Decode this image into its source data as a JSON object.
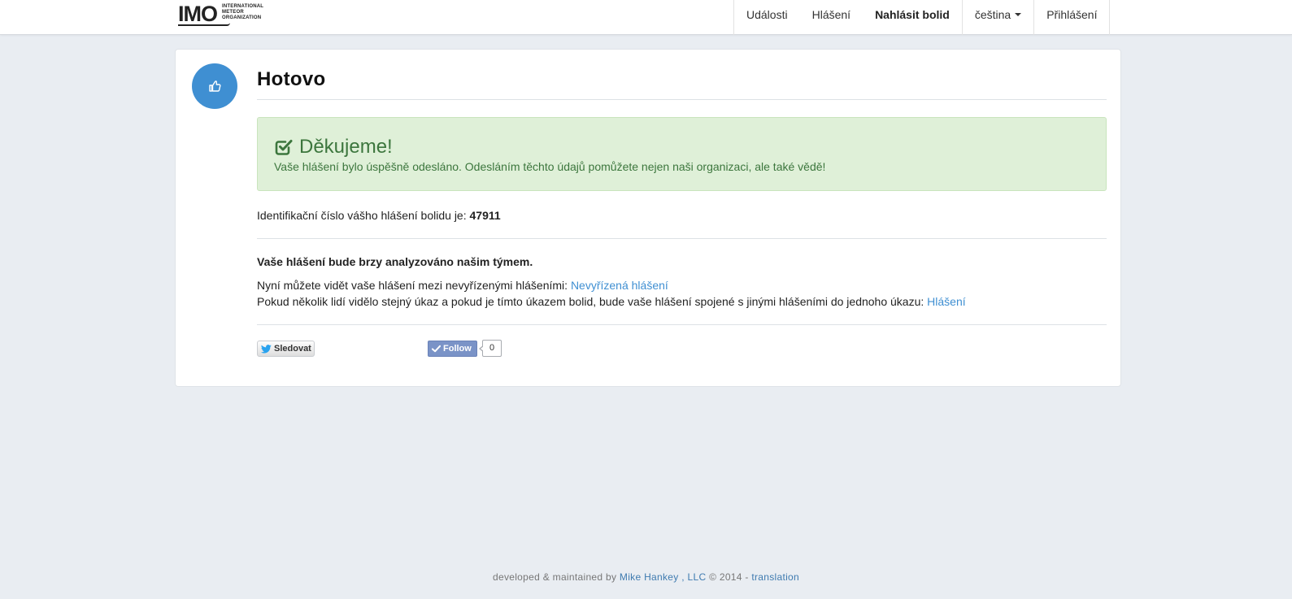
{
  "logo": {
    "mark": "IMO",
    "line1": "INTERNATIONAL",
    "line2": "METEOR",
    "line3": "ORGANIZATION"
  },
  "nav": {
    "items": [
      {
        "label": "Události"
      },
      {
        "label": "Hlášení"
      },
      {
        "label": "Nahlásit bolid"
      },
      {
        "label": "čeština"
      },
      {
        "label": "Přihlášení"
      }
    ]
  },
  "page": {
    "title": "Hotovo",
    "icon": "thumbs-up-icon"
  },
  "alert": {
    "title": "Děkujeme!",
    "message": "Vaše hlášení bylo úspěšně odesláno. Odesláním těchto údajů pomůžete nejen naši organizaci, ale také vědě!",
    "icon": "check-square-icon"
  },
  "report": {
    "id_label": "Identifikační číslo vášho hlášení bolidu je:",
    "id_value": "47911"
  },
  "info": {
    "analyze": "Vaše hlášení bude brzy analyzováno našim týmem.",
    "line_a": "Nyní můžete vidět vaše hlášení mezi nevyřízenými hlášeními:",
    "line_a_link": "Nevyřízená hlášení",
    "line_b": "Pokud několik lidí vidělo stejný úkaz a pokud je tímto úkazem bolid, bude vaše hlášení spojené s jinými hlášeními do jednoho úkazu:",
    "line_b_link": "Hlášení"
  },
  "social": {
    "twitter_label": "Sledovat",
    "fb_label": "Follow",
    "fb_count": "0"
  },
  "footer": {
    "prefix": "developed & maintained by",
    "author": "Mike Hankey",
    "sep": ",",
    "company": "LLC",
    "copy": "© 2014 -",
    "translation": "translation"
  },
  "colors": {
    "accent": "#3f8fd2",
    "success_bg": "#dff0d8",
    "success_text": "#3c763d",
    "page_bg": "#e9edf2"
  }
}
